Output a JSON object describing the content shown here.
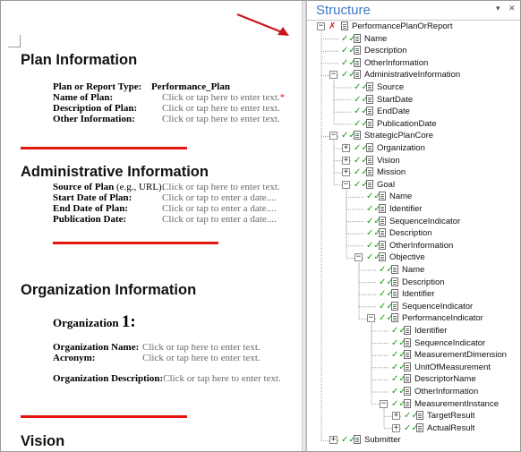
{
  "document": {
    "plan_info": {
      "heading": "Plan Information",
      "fields": [
        {
          "label": "Plan or Report Type:",
          "value": "Performance_Plan",
          "kind": "value"
        },
        {
          "label": "Name of Plan:",
          "value": "Click or tap here to enter text.",
          "kind": "placeholder",
          "required_mark": "*"
        },
        {
          "label": "Description of Plan:",
          "value": "Click or tap here to enter text.",
          "kind": "placeholder"
        },
        {
          "label": "Other Information:",
          "value": "Click or tap here to enter text.",
          "kind": "placeholder"
        }
      ]
    },
    "admin_info": {
      "heading": "Administrative Information",
      "fields": [
        {
          "label": "Source of Plan",
          "label_suffix": " (e.g., URL):",
          "value": "Click or tap here to enter text."
        },
        {
          "label": "Start Date of Plan:",
          "value": "Click or tap to enter a date...."
        },
        {
          "label": "End Date of Plan:",
          "value": "Click or tap to enter a date...."
        },
        {
          "label": "Publication Date:",
          "value": "Click or tap to enter a date...."
        }
      ]
    },
    "org_info": {
      "heading": "Organization Information",
      "org_title": "Organization ",
      "org_number": "1:",
      "fields": [
        {
          "label": "Organization Name:",
          "value": "Click or tap here to enter text."
        },
        {
          "label": "Acronym:",
          "value": "Click or tap here to enter text."
        },
        {
          "label": "Organization Description:",
          "value": "Click or tap here to enter text."
        }
      ]
    },
    "vision": {
      "heading": "Vision"
    }
  },
  "structure_pane": {
    "title": "Structure",
    "controls": [
      "▾",
      "✕"
    ],
    "tree": [
      {
        "label": "PerformancePlanOrReport",
        "depth": 0,
        "expander": "−",
        "mark": "x"
      },
      {
        "label": "Name",
        "depth": 1,
        "mark": "check"
      },
      {
        "label": "Description",
        "depth": 1,
        "mark": "check"
      },
      {
        "label": "OtherInformation",
        "depth": 1,
        "mark": "check"
      },
      {
        "label": "AdministrativeInformation",
        "depth": 1,
        "expander": "−",
        "mark": "check"
      },
      {
        "label": "Source",
        "depth": 2,
        "mark": "check"
      },
      {
        "label": "StartDate",
        "depth": 2,
        "mark": "check"
      },
      {
        "label": "EndDate",
        "depth": 2,
        "mark": "check"
      },
      {
        "label": "PublicationDate",
        "depth": 2,
        "mark": "check"
      },
      {
        "label": "StrategicPlanCore",
        "depth": 1,
        "expander": "−",
        "mark": "check"
      },
      {
        "label": "Organization",
        "depth": 2,
        "expander": "+",
        "mark": "check"
      },
      {
        "label": "Vision",
        "depth": 2,
        "expander": "+",
        "mark": "check"
      },
      {
        "label": "Mission",
        "depth": 2,
        "expander": "+",
        "mark": "check"
      },
      {
        "label": "Goal",
        "depth": 2,
        "expander": "−",
        "mark": "check"
      },
      {
        "label": "Name",
        "depth": 3,
        "mark": "check"
      },
      {
        "label": "Identifier",
        "depth": 3,
        "mark": "check"
      },
      {
        "label": "SequenceIndicator",
        "depth": 3,
        "mark": "check"
      },
      {
        "label": "Description",
        "depth": 3,
        "mark": "check"
      },
      {
        "label": "OtherInformation",
        "depth": 3,
        "mark": "check"
      },
      {
        "label": "Objective",
        "depth": 3,
        "expander": "−",
        "mark": "check"
      },
      {
        "label": "Name",
        "depth": 4,
        "mark": "check"
      },
      {
        "label": "Description",
        "depth": 4,
        "mark": "check"
      },
      {
        "label": "Identifier",
        "depth": 4,
        "mark": "check"
      },
      {
        "label": "SequenceIndicator",
        "depth": 4,
        "mark": "check"
      },
      {
        "label": "PerformanceIndicator",
        "depth": 4,
        "expander": "−",
        "mark": "check"
      },
      {
        "label": "Identifier",
        "depth": 5,
        "mark": "check"
      },
      {
        "label": "SequenceIndicator",
        "depth": 5,
        "mark": "check"
      },
      {
        "label": "MeasurementDimension",
        "depth": 5,
        "mark": "check"
      },
      {
        "label": "UnitOfMeasurement",
        "depth": 5,
        "mark": "check"
      },
      {
        "label": "DescriptorName",
        "depth": 5,
        "mark": "check"
      },
      {
        "label": "OtherInformation",
        "depth": 5,
        "mark": "check"
      },
      {
        "label": "MeasurementInstance",
        "depth": 5,
        "expander": "−",
        "mark": "check"
      },
      {
        "label": "TargetResult",
        "depth": 6,
        "expander": "+",
        "mark": "check"
      },
      {
        "label": "ActualResult",
        "depth": 6,
        "expander": "+",
        "mark": "check"
      },
      {
        "label": "Submitter",
        "depth": 1,
        "expander": "+",
        "mark": "check"
      }
    ]
  },
  "colors": {
    "rule": "#e3150e",
    "pane_title": "#3b78c4",
    "check": "#1a9a1a",
    "error_x": "#d21e1e",
    "arrow": "#c8151b",
    "placeholder": "#6a6a6a"
  }
}
